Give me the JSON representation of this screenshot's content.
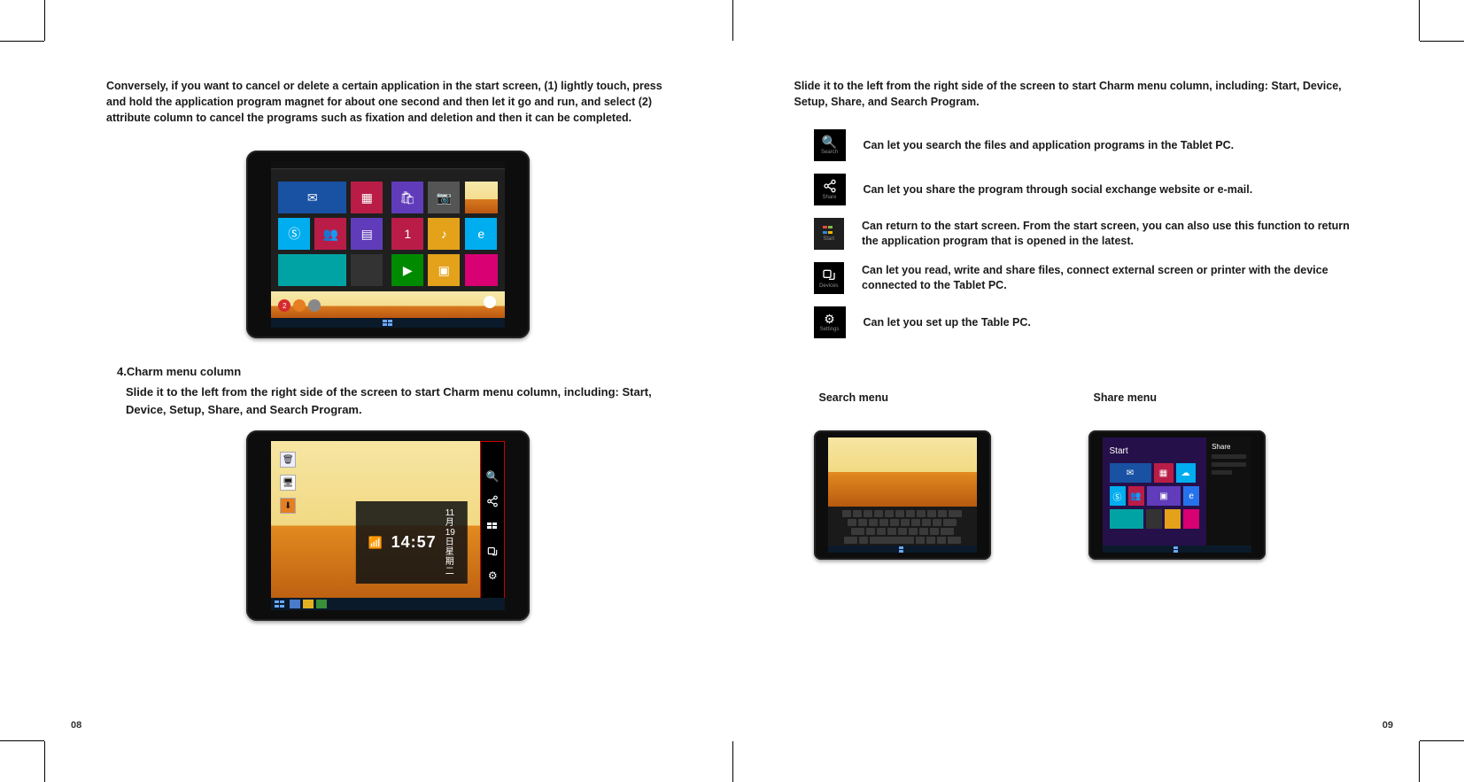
{
  "left": {
    "intro": "Conversely, if you want to cancel or delete a certain application in the start screen, (1) lightly touch, press and hold the application program magnet for about one second and then let it go and run, and select (2) attribute column to cancel the programs such as fixation and deletion and then it can be completed.",
    "section4_title": "4.Charm menu column",
    "section4_body": "Slide it to the left from the right side of the screen to start Charm menu column, including: Start, Device, Setup, Share, and Search Program.",
    "clock_time": "14:57",
    "clock_date_line1": "11月19日",
    "clock_date_line2": "星期二",
    "page_num": "08"
  },
  "right": {
    "intro": "Slide it to the left from the right side of the screen to start Charm menu column, including: Start, Device, Setup, Share, and Search Program.",
    "charms": [
      {
        "label": "Search",
        "desc": "Can let you search the files and application programs in the Tablet PC."
      },
      {
        "label": "Share",
        "desc": "Can let you share the program through social exchange website or e-mail."
      },
      {
        "label": "Start",
        "desc": "Can return to the start screen. From the start screen, you can also use this function to return the application program that is opened in the latest."
      },
      {
        "label": "Devices",
        "desc": "Can let you read, write and share files, connect external screen or printer with the device connected to the Tablet PC."
      },
      {
        "label": "Settings",
        "desc": "Can let you set up the Table PC."
      }
    ],
    "search_menu_title": "Search menu",
    "share_menu_title": "Share menu",
    "share_start_label": "Start",
    "share_panel_label": "Share",
    "page_num": "09"
  }
}
